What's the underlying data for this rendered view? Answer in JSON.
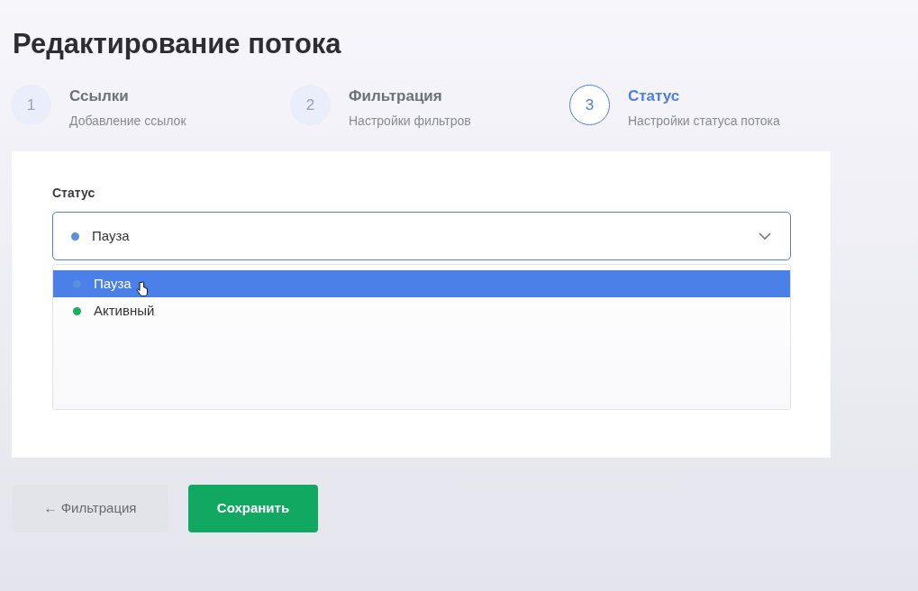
{
  "title": "Редактирование потока",
  "steps": [
    {
      "number": "1",
      "title": "Ссылки",
      "subtitle": "Добавление ссылок",
      "selected": false
    },
    {
      "number": "2",
      "title": "Фильтрация",
      "subtitle": "Настройки фильтров",
      "selected": false
    },
    {
      "number": "3",
      "title": "Статус",
      "subtitle": "Настройки статуса потока",
      "selected": true
    }
  ],
  "status_field": {
    "label": "Статус",
    "value": "Пауза",
    "color": "#5b8fdc",
    "expanded": true,
    "options": [
      {
        "label": "Пауза",
        "color": "#5b8fdc",
        "selected": true
      },
      {
        "label": "Активный",
        "color": "#1bb05e",
        "selected": false
      }
    ]
  },
  "buttons": {
    "back": "← Фильтрация",
    "save": "Сохранить"
  }
}
